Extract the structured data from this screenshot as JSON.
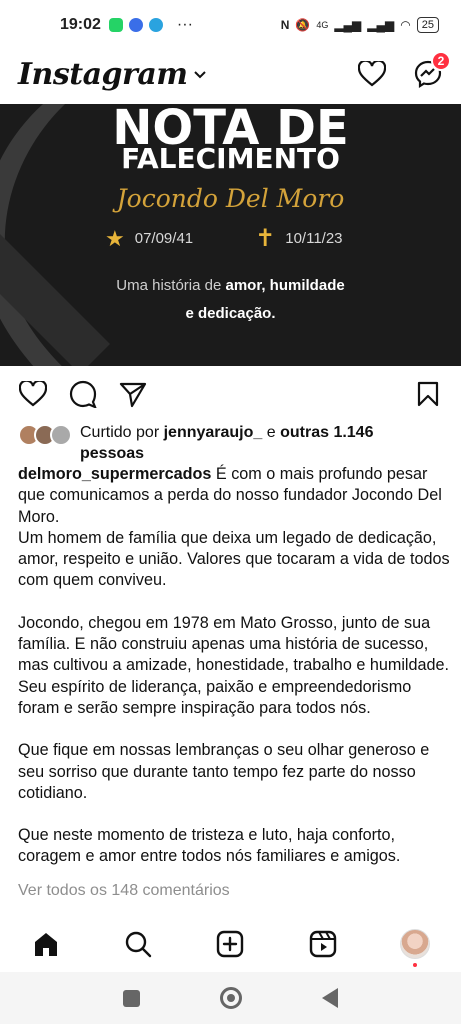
{
  "status_bar": {
    "time": "19:02",
    "battery": "25",
    "network": "4G"
  },
  "header": {
    "logo": "Instagram",
    "notifications_badge": "2"
  },
  "post_image": {
    "title_line1": "NOTA DE",
    "title_line2": "FALECIMENTO",
    "name": "Jocondo Del Moro",
    "birth_date": "07/09/41",
    "death_date": "10/11/23",
    "history_prefix": "Uma história de ",
    "history_bold1": "amor, humildade",
    "history_bold2": "e dedicação."
  },
  "likes": {
    "prefix": "Curtido por ",
    "user": "jennyaraujo_",
    "middle": " e ",
    "others": "outras 1.146",
    "suffix": "pessoas"
  },
  "caption": {
    "username": "delmoro_supermercados",
    "p1": " É com o mais profundo pesar que comunicamos a perda do nosso fundador Jocondo Del Moro.",
    "p2": "Um homem de família que deixa um legado de dedicação, amor, respeito e união. Valores que tocaram a vida de todos com quem conviveu.",
    "p3": "Jocondo, chegou em 1978 em Mato Grosso, junto de sua família. E não construiu apenas uma história de sucesso, mas cultivou a amizade, honestidade, trabalho e humildade. Seu espírito de liderança, paixão e empreendedorismo foram e serão sempre inspiração para todos nós.",
    "p4": "Que fique em nossas lembranças o seu olhar generoso e seu sorriso que durante tanto tempo fez parte do nosso cotidiano.",
    "p5": "Que neste momento de tristeza e luto, haja conforto, coragem e amor entre todos nós familiares e amigos."
  },
  "comments": {
    "view_all": "Ver todos os 148 comentários"
  },
  "icons": {
    "like": "heart-icon",
    "comment": "comment-icon",
    "share": "send-icon",
    "save": "bookmark-icon",
    "home": "home-icon",
    "search": "search-icon",
    "create": "create-icon",
    "reels": "reels-icon"
  }
}
